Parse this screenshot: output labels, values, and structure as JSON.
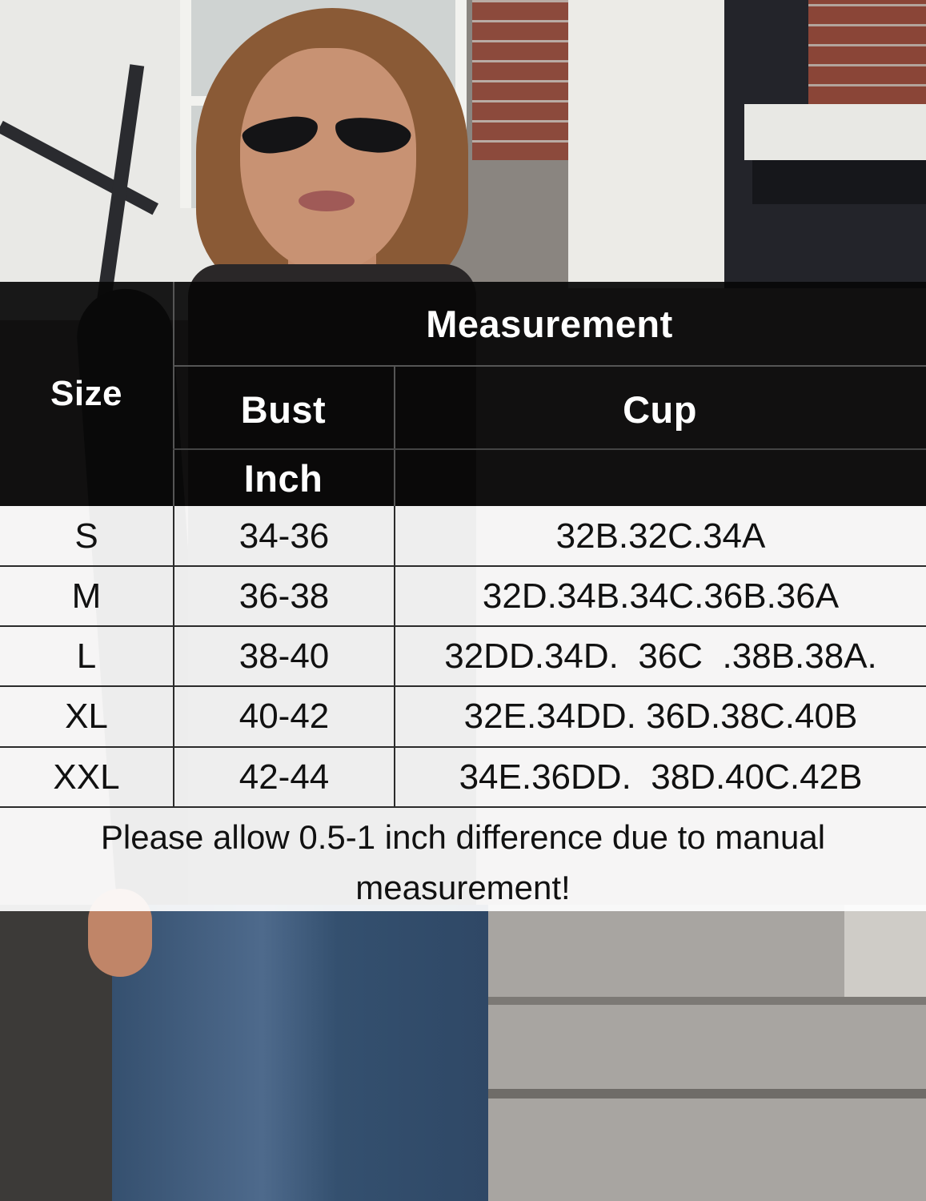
{
  "table": {
    "header": {
      "size": "Size",
      "measurement": "Measurement",
      "bust": "Bust",
      "cup": "Cup",
      "unit": "Inch"
    },
    "rows": [
      {
        "size": "S",
        "bust": "34-36",
        "cup": "32B.32C.34A"
      },
      {
        "size": "M",
        "bust": "36-38",
        "cup": "32D.34B.34C.36B.36A"
      },
      {
        "size": "L",
        "bust": "38-40",
        "cup": "32DD.34D.  36C  .38B.38A."
      },
      {
        "size": "XL",
        "bust": "40-42",
        "cup": "32E.34DD. 36D.38C.40B"
      },
      {
        "size": "XXL",
        "bust": "42-44",
        "cup": "34E.36DD.  38D.40C.42B"
      }
    ],
    "note": "Please allow 0.5-1 inch difference due to manual measurement!"
  }
}
